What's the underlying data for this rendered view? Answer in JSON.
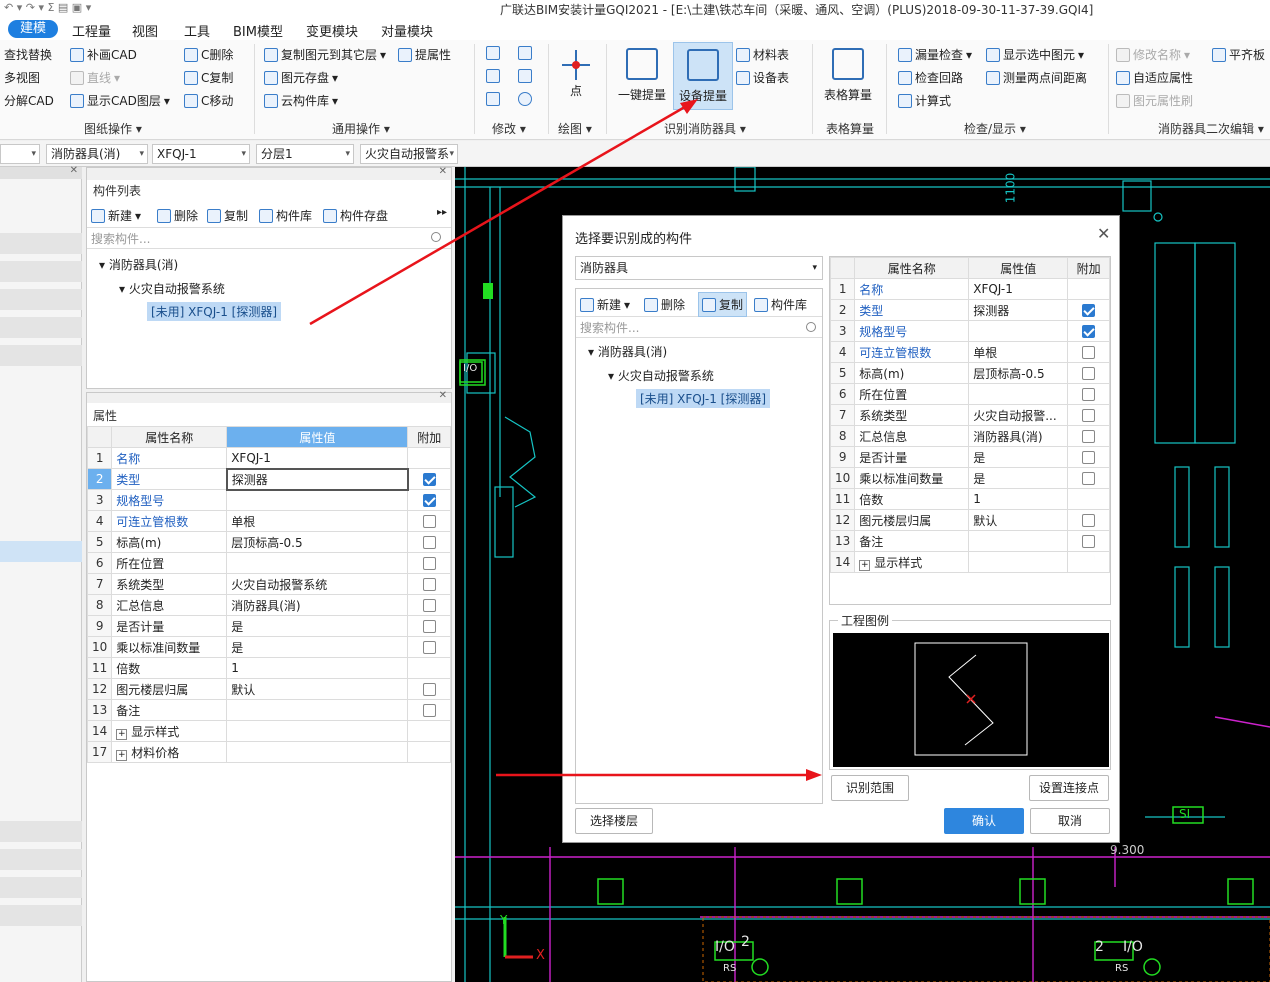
{
  "titlebar": {
    "title": "广联达BIM安装计量GQI2021 - [E:\\土建\\铁芯车间（采暖、通风、空调）(PLUS)2018-09-30-11-37-39.GQI4]"
  },
  "menu": [
    "建模",
    "工程量",
    "视图",
    "工具",
    "BIM模型",
    "变更模块",
    "对量模块"
  ],
  "ribbon": {
    "drawing_ops": {
      "items": [
        "查找替换",
        "补画CAD",
        "C删除",
        "多视图",
        "直线",
        "C复制",
        "分解CAD",
        "显示CAD图层",
        "C移动"
      ],
      "label": "图纸操作"
    },
    "common_ops": {
      "items": [
        "复制图元到其它层",
        "提属性",
        "图元存盘",
        "云构件库"
      ],
      "label": "通用操作"
    },
    "modify": {
      "label": "修改"
    },
    "draw": {
      "point": "点",
      "label": "绘图"
    },
    "recognize": {
      "one_click": "一键提量",
      "device": "设备提量",
      "material_table": "材料表",
      "device_table": "设备表",
      "label": "识别消防器具"
    },
    "table_calc": {
      "item": "表格算量",
      "label": "表格算量"
    },
    "check": {
      "items": [
        "漏量检查",
        "显示选中图元",
        "检查回路",
        "测量两点间距离",
        "计算式"
      ],
      "label": "检查/显示"
    },
    "secondary": {
      "items": [
        "修改名称",
        "平齐板",
        "自适应属性",
        "图元属性刷"
      ],
      "label": "消防器具二次编辑"
    }
  },
  "selectors": [
    "消防器具(消)",
    "XFQJ-1",
    "分层1",
    "火灾自动报警系"
  ],
  "component_list": {
    "title": "构件列表",
    "toolbar": [
      "新建",
      "删除",
      "复制",
      "构件库",
      "构件存盘"
    ],
    "search_placeholder": "搜索构件...",
    "tree": {
      "root": "消防器具(消)",
      "child": "火灾自动报警系统",
      "leaf": "[未用] XFQJ-1 [探测器]"
    }
  },
  "properties": {
    "title": "属性",
    "headers": [
      "属性名称",
      "属性值",
      "附加"
    ],
    "rows": [
      {
        "n": "1",
        "name": "名称",
        "value": "XFQJ-1",
        "blue": true,
        "cb": "none"
      },
      {
        "n": "2",
        "name": "类型",
        "value": "探测器",
        "blue": true,
        "cb": "on"
      },
      {
        "n": "3",
        "name": "规格型号",
        "value": "",
        "blue": true,
        "cb": "on"
      },
      {
        "n": "4",
        "name": "可连立管根数",
        "value": "单根",
        "blue": true,
        "cb": "off"
      },
      {
        "n": "5",
        "name": "标高(m)",
        "value": "层顶标高-0.5",
        "blue": false,
        "cb": "off"
      },
      {
        "n": "6",
        "name": "所在位置",
        "value": "",
        "blue": false,
        "cb": "off"
      },
      {
        "n": "7",
        "name": "系统类型",
        "value": "火灾自动报警系统",
        "blue": false,
        "cb": "off"
      },
      {
        "n": "8",
        "name": "汇总信息",
        "value": "消防器具(消)",
        "blue": false,
        "cb": "off"
      },
      {
        "n": "9",
        "name": "是否计量",
        "value": "是",
        "blue": false,
        "cb": "off"
      },
      {
        "n": "10",
        "name": "乘以标准间数量",
        "value": "是",
        "blue": false,
        "cb": "off"
      },
      {
        "n": "11",
        "name": "倍数",
        "value": "1",
        "blue": false,
        "cb": "none"
      },
      {
        "n": "12",
        "name": "图元楼层归属",
        "value": "默认",
        "blue": false,
        "cb": "off"
      },
      {
        "n": "13",
        "name": "备注",
        "value": "",
        "blue": false,
        "cb": "off"
      },
      {
        "n": "14",
        "name": "显示样式",
        "value": "",
        "blue": false,
        "cb": "none",
        "expand": true
      },
      {
        "n": "17",
        "name": "材料价格",
        "value": "",
        "blue": false,
        "cb": "none",
        "expand": true
      }
    ]
  },
  "dialog": {
    "title": "选择要识别成的构件",
    "combo": "消防器具",
    "toolbar": [
      "新建",
      "删除",
      "复制",
      "构件库"
    ],
    "search_placeholder": "搜索构件...",
    "tree": {
      "root": "消防器具(消)",
      "child": "火灾自动报警系统",
      "leaf": "[未用] XFQJ-1 [探测器]"
    },
    "headers": [
      "属性名称",
      "属性值",
      "附加"
    ],
    "rows": [
      {
        "n": "1",
        "name": "名称",
        "value": "XFQJ-1",
        "blue": true,
        "cb": "none"
      },
      {
        "n": "2",
        "name": "类型",
        "value": "探测器",
        "blue": true,
        "cb": "on"
      },
      {
        "n": "3",
        "name": "规格型号",
        "value": "",
        "blue": true,
        "cb": "on"
      },
      {
        "n": "4",
        "name": "可连立管根数",
        "value": "单根",
        "blue": true,
        "cb": "off"
      },
      {
        "n": "5",
        "name": "标高(m)",
        "value": "层顶标高-0.5",
        "blue": false,
        "cb": "off"
      },
      {
        "n": "6",
        "name": "所在位置",
        "value": "",
        "blue": false,
        "cb": "off"
      },
      {
        "n": "7",
        "name": "系统类型",
        "value": "火灾自动报警...",
        "blue": false,
        "cb": "off"
      },
      {
        "n": "8",
        "name": "汇总信息",
        "value": "消防器具(消)",
        "blue": false,
        "cb": "off"
      },
      {
        "n": "9",
        "name": "是否计量",
        "value": "是",
        "blue": false,
        "cb": "off"
      },
      {
        "n": "10",
        "name": "乘以标准间数量",
        "value": "是",
        "blue": false,
        "cb": "off"
      },
      {
        "n": "11",
        "name": "倍数",
        "value": "1",
        "blue": false,
        "cb": "none"
      },
      {
        "n": "12",
        "name": "图元楼层归属",
        "value": "默认",
        "blue": false,
        "cb": "off"
      },
      {
        "n": "13",
        "name": "备注",
        "value": "",
        "blue": false,
        "cb": "off"
      },
      {
        "n": "14",
        "name": "显示样式",
        "value": "",
        "blue": false,
        "cb": "none",
        "expand": true
      }
    ],
    "legend_title": "工程图例",
    "buttons": {
      "range": "识别范围",
      "connect": "设置连接点",
      "floor": "选择楼层",
      "ok": "确认",
      "cancel": "取消"
    }
  },
  "canvas_labels": {
    "dim": "1100",
    "elev": "9.300",
    "s1": "SI",
    "io": "I/O",
    "rs": "RS",
    "two": "2",
    "x": "X",
    "y": "Y"
  },
  "colors": {
    "accent": "#1e7fe0",
    "arrow": "#e8141b",
    "cad_cyan": "#16c4c4",
    "cad_magenta": "#cc22cc",
    "cad_green": "#22dd22"
  }
}
